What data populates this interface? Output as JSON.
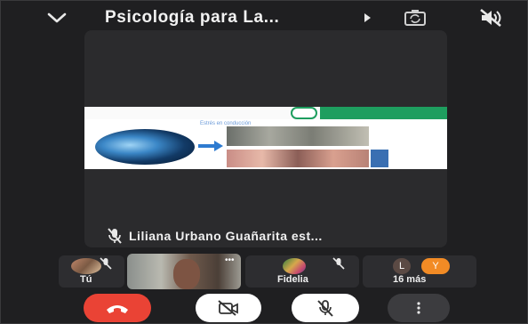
{
  "header": {
    "title": "Psicología para La...",
    "collapse_icon": "chevron-down-icon",
    "more_icon": "caret-right-icon",
    "switch_camera_icon": "switch-camera-icon",
    "audio_icon": "volume-off-icon"
  },
  "main_tile": {
    "presenter_name": "Liliana Urbano Guañarita est...",
    "slide_subtitle": "Estrés en conducción",
    "mic_icon": "mic-off-icon"
  },
  "participants": [
    {
      "label": "Tú",
      "muted": true
    },
    {
      "label": "",
      "muted": false
    },
    {
      "label": "Fidelia",
      "muted": true
    },
    {
      "label": "16 más",
      "initials": [
        "L",
        "Y"
      ]
    }
  ],
  "controls": {
    "end_call_icon": "end-call-icon",
    "camera_icon": "camera-off-icon",
    "mic_icon": "mic-off-icon",
    "more_icon": "more-vertical-icon"
  },
  "colors": {
    "background": "#1f1f21",
    "end_call": "#ea4335",
    "control_bg": "#ffffff",
    "more_bg": "#3c3c3f",
    "avatar_l": "#5b4a44",
    "avatar_y": "#f28b25"
  }
}
